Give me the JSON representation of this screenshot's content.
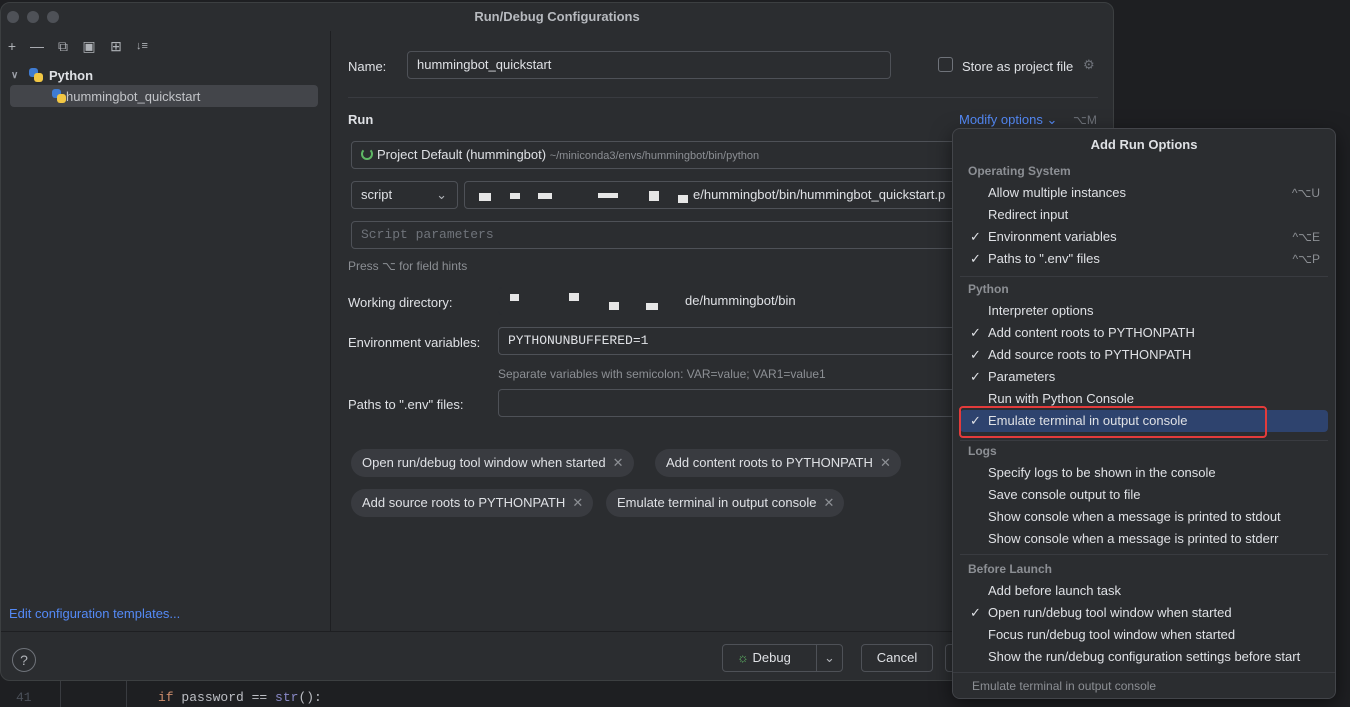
{
  "window": {
    "title": "Run/Debug Configurations"
  },
  "toolbar": {
    "icons": [
      "add-icon",
      "remove-icon",
      "copy-icon",
      "save-icon",
      "new-folder-icon",
      "sort-icon"
    ]
  },
  "tree": {
    "group_label": "Python",
    "item_label": "hummingbot_quickstart",
    "edit_templates_link": "Edit configuration templates..."
  },
  "form": {
    "name_label": "Name:",
    "name_value": "hummingbot_quickstart",
    "store_label": "Store as project file",
    "run_heading": "Run",
    "modify_options": "Modify options",
    "modify_shortcut": "⌥M",
    "interpreter_name": "Project Default (hummingbot)",
    "interpreter_path": "~/miniconda3/envs/hummingbot/bin/python",
    "script_type": "script",
    "script_path_visible": "e/hummingbot/bin/hummingbot_quickstart.p",
    "script_params_placeholder": "Script parameters",
    "field_hint": "Press ⌥ for field hints",
    "workdir_label": "Working directory:",
    "workdir_visible": "de/hummingbot/bin",
    "env_label": "Environment variables:",
    "env_value": "PYTHONUNBUFFERED=1",
    "env_hint": "Separate variables with semicolon: VAR=value; VAR1=value1",
    "dotenv_label": "Paths to \".env\" files:",
    "chips": [
      "Open run/debug tool window when started",
      "Add content roots to PYTHONPATH",
      "Add source roots to PYTHONPATH",
      "Emulate terminal in output console"
    ]
  },
  "footer": {
    "help": "?",
    "debug_label": "Debug",
    "cancel_label": "Cancel"
  },
  "popup": {
    "title": "Add Run Options",
    "sections": {
      "os": "Operating System",
      "python": "Python",
      "logs": "Logs",
      "before": "Before Launch"
    },
    "os_options": [
      {
        "label": "Allow multiple instances",
        "checked": false,
        "shortcut": "^⌥U"
      },
      {
        "label": "Redirect input",
        "checked": false,
        "shortcut": ""
      },
      {
        "label": "Environment variables",
        "checked": true,
        "shortcut": "^⌥E"
      },
      {
        "label": "Paths to \".env\" files",
        "checked": true,
        "shortcut": "^⌥P"
      }
    ],
    "python_options": [
      {
        "label": "Interpreter options",
        "checked": false
      },
      {
        "label": "Add content roots to PYTHONPATH",
        "checked": true
      },
      {
        "label": "Add source roots to PYTHONPATH",
        "checked": true
      },
      {
        "label": "Parameters",
        "checked": true
      },
      {
        "label": "Run with Python Console",
        "checked": false
      },
      {
        "label": "Emulate terminal in output console",
        "checked": true,
        "selected": true
      }
    ],
    "log_options": [
      {
        "label": "Specify logs to be shown in the console",
        "checked": false
      },
      {
        "label": "Save console output to file",
        "checked": false
      },
      {
        "label": "Show console when a message is printed to stdout",
        "checked": false
      },
      {
        "label": "Show console when a message is printed to stderr",
        "checked": false
      }
    ],
    "before_options": [
      {
        "label": "Add before launch task",
        "checked": false
      },
      {
        "label": "Open run/debug tool window when started",
        "checked": true
      },
      {
        "label": "Focus run/debug tool window when started",
        "checked": false
      },
      {
        "label": "Show the run/debug configuration settings before start",
        "checked": false
      }
    ],
    "status": "Emulate terminal in output console",
    "check_glyph": "✓"
  },
  "editor": {
    "line_number": "41",
    "code_kw": "if",
    "code_mid": " password == ",
    "code_fn": "str",
    "code_end": "():"
  },
  "colors": {
    "accent": "#548af7",
    "selection": "#2e436e",
    "highlight_border": "#e33b3b"
  }
}
